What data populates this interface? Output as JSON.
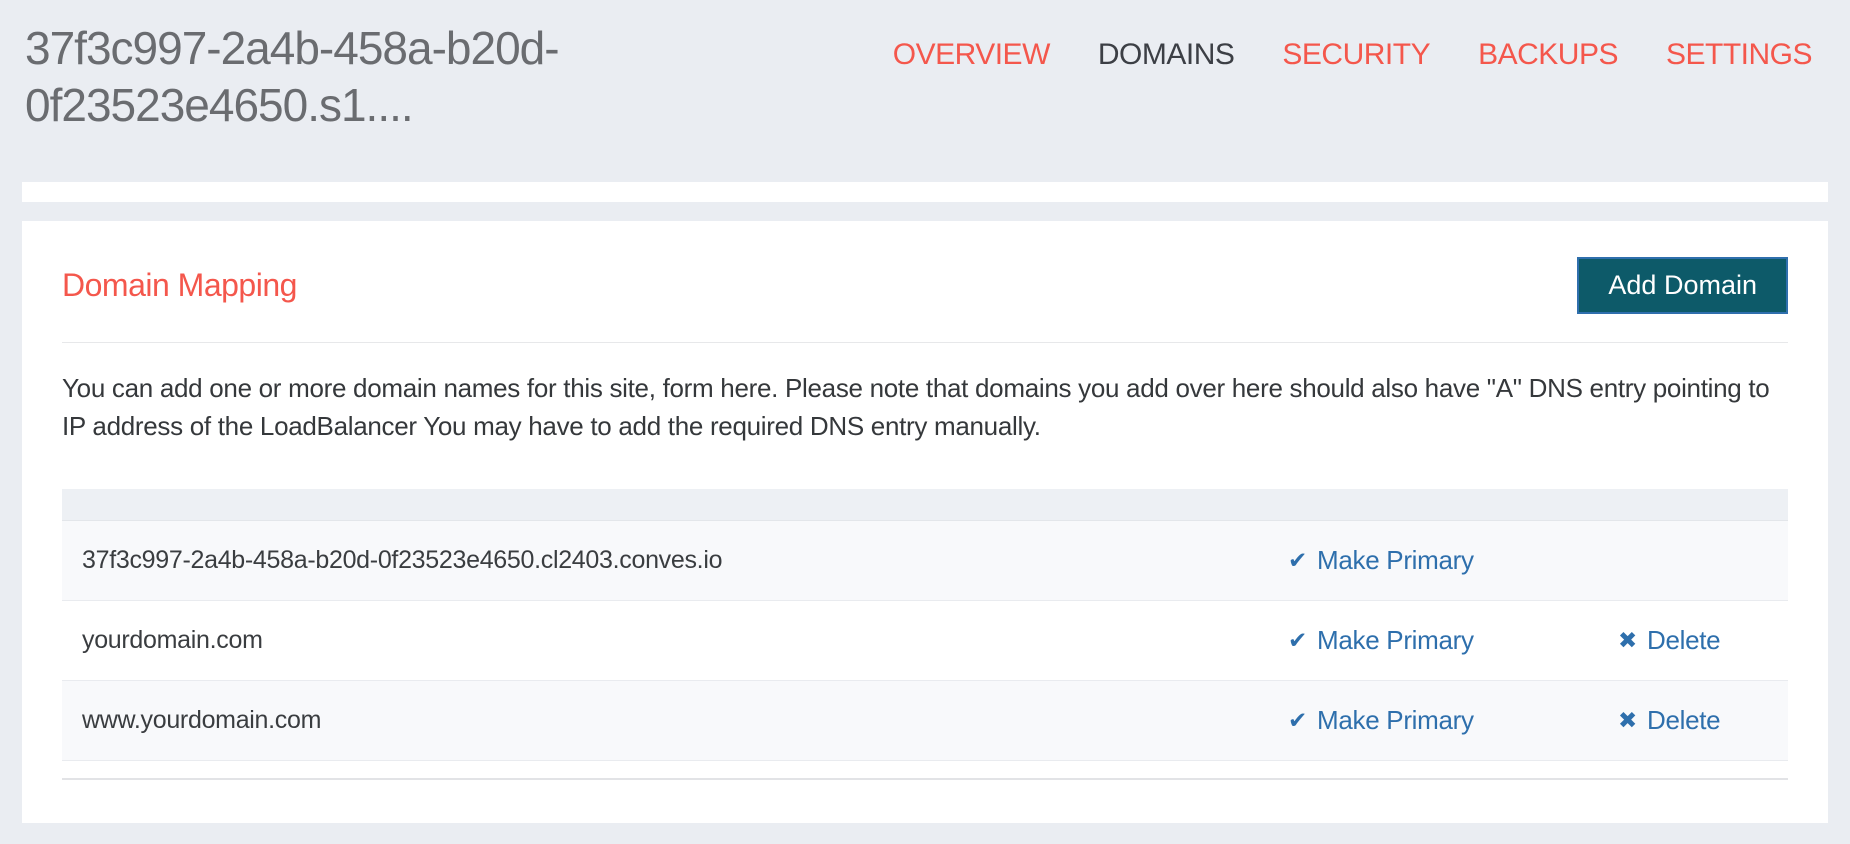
{
  "colors": {
    "page_background": "#eaedf2",
    "accent_red": "#f4574c",
    "nav_active_gray": "#3c3f45",
    "link_blue": "#2e6fac",
    "button_teal": "#0d5a69",
    "button_border_blue": "#2f6fad"
  },
  "header": {
    "site_title": "37f3c997-2a4b-458a-b20d-0f23523e4650.s1....",
    "nav": [
      {
        "label": "OVERVIEW",
        "active": false
      },
      {
        "label": "DOMAINS",
        "active": true
      },
      {
        "label": "SECURITY",
        "active": false
      },
      {
        "label": "BACKUPS",
        "active": false
      },
      {
        "label": "SETTINGS",
        "active": false
      }
    ]
  },
  "card": {
    "title": "Domain Mapping",
    "add_button_label": "Add Domain",
    "description": "You can add one or more domain names for this site, form here. Please note that domains you add over here should also have \"A\" DNS entry pointing to IP address of the LoadBalancer You may have to add the required DNS entry manually.",
    "table": {
      "rows": [
        {
          "domain": "37f3c997-2a4b-458a-b20d-0f23523e4650.cl2403.conves.io",
          "make_primary_label": "Make Primary"
        },
        {
          "domain": "yourdomain.com",
          "make_primary_label": "Make Primary",
          "delete_label": "Delete"
        },
        {
          "domain": "www.yourdomain.com",
          "make_primary_label": "Make Primary",
          "delete_label": "Delete"
        }
      ]
    }
  },
  "icons": {
    "check": "✔",
    "delete_x": "✖"
  }
}
